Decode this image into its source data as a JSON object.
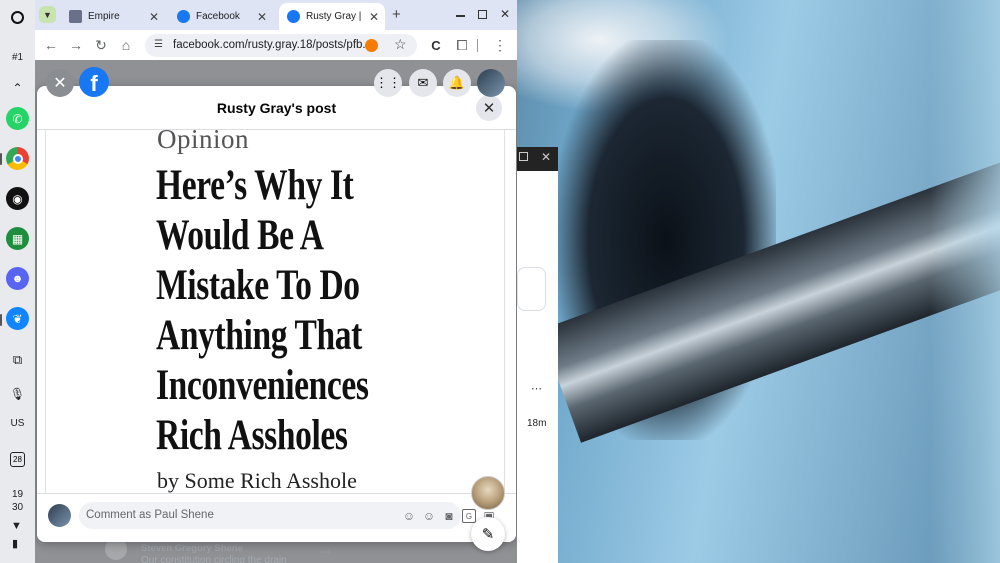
{
  "shelf": {
    "launcher_icon": "launcher-circle-icon",
    "desk_label": "#1",
    "collapse_icon": "chevron-up-icon",
    "apps": [
      "whatsapp-icon",
      "chrome-icon",
      "podcast-icon",
      "app-grid-icon",
      "discord-icon",
      "bluesky-icon"
    ],
    "tray": {
      "keyboard_label": "US",
      "calendar_day": "28",
      "time_hour": "19",
      "time_minute": "30"
    }
  },
  "browser": {
    "tabs": [
      {
        "title": "Empire"
      },
      {
        "title": "Facebook"
      },
      {
        "title": "Rusty Gray | Fa"
      }
    ],
    "new_tab_label": "+",
    "url": "facebook.com/rusty.gray.18/posts/pfb..."
  },
  "facebook": {
    "modal_title": "Rusty Gray's post",
    "post_image": {
      "section": "Opinion",
      "headline": "Here’s Why It\nWould Be A\nMistake To Do\nAnything That\nInconveniences\nRich Assholes",
      "byline": "by Some Rich Asshole"
    },
    "comment_placeholder": "Comment as Paul Shene",
    "background_comment_author": "Steven Gregory Shene",
    "background_comment_text": "Our constitution circling the drain"
  },
  "background_window": {
    "time": "18m",
    "more": "⋯"
  },
  "colors": {
    "facebook_blue": "#1877f2",
    "tabstrip": "#dfe4f5",
    "shelf": "#e9eaee"
  }
}
